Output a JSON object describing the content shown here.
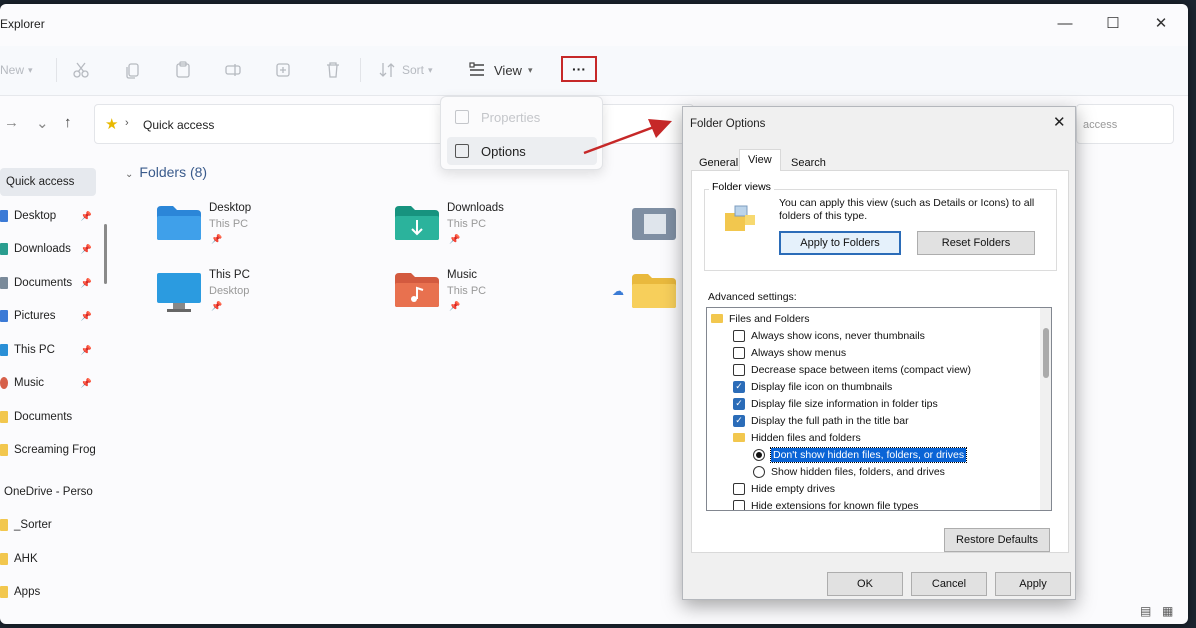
{
  "window": {
    "title": "Explorer",
    "minimize": "—",
    "maximize": "☐",
    "close": "✕"
  },
  "toolbar": {
    "new_label": "New",
    "sort_label": "Sort",
    "view_label": "View",
    "more_label": "···"
  },
  "address": {
    "breadcrumb": "Quick access",
    "search_placeholder": "access"
  },
  "sidebar": {
    "items": [
      {
        "label": "Quick access",
        "color": "#3b7ad6"
      },
      {
        "label": "Desktop",
        "color": "#3b7ad6"
      },
      {
        "label": "Downloads",
        "color": "#2a9d8f"
      },
      {
        "label": "Documents",
        "color": "#7a8a9a"
      },
      {
        "label": "Pictures",
        "color": "#3b7ad6"
      },
      {
        "label": "This PC",
        "color": "#2a8fd6"
      },
      {
        "label": "Music",
        "color": "#d6604a"
      },
      {
        "label": "Documents",
        "color": "#f2c74e"
      },
      {
        "label": "Screaming Frog",
        "color": "#f2c74e"
      },
      {
        "label": "OneDrive - Perso",
        "color": "#1a73e8"
      },
      {
        "label": "_Sorter",
        "color": "#f2c74e"
      },
      {
        "label": "AHK",
        "color": "#f2c74e"
      },
      {
        "label": "Apps",
        "color": "#f2c74e"
      }
    ]
  },
  "content": {
    "section_title": "Folders (8)",
    "folders": [
      {
        "name": "Desktop",
        "sub": "This PC",
        "color": "#2b86d8"
      },
      {
        "name": "Downloads",
        "sub": "This PC",
        "color": "#22a38f"
      },
      {
        "name": "This PC",
        "sub": "Desktop",
        "color": "#2b9be0"
      },
      {
        "name": "Music",
        "sub": "This PC",
        "color": "#e0674a"
      }
    ]
  },
  "more_menu": {
    "properties": "Properties",
    "options": "Options"
  },
  "dialog": {
    "title": "Folder Options",
    "tabs": [
      "General",
      "View",
      "Search"
    ],
    "folder_views_label": "Folder views",
    "folder_views_text": "You can apply this view (such as Details or Icons) to all folders of this type.",
    "apply_to_folders": "Apply to Folders",
    "reset_folders": "Reset Folders",
    "advanced_label": "Advanced settings:",
    "settings": [
      {
        "type": "folder",
        "label": "Files and Folders",
        "indent": 0
      },
      {
        "type": "checkbox",
        "label": "Always show icons, never thumbnails",
        "checked": false,
        "indent": 1
      },
      {
        "type": "checkbox",
        "label": "Always show menus",
        "checked": false,
        "indent": 1
      },
      {
        "type": "checkbox",
        "label": "Decrease space between items (compact view)",
        "checked": false,
        "indent": 1
      },
      {
        "type": "checkbox",
        "label": "Display file icon on thumbnails",
        "checked": true,
        "indent": 1
      },
      {
        "type": "checkbox",
        "label": "Display file size information in folder tips",
        "checked": true,
        "indent": 1
      },
      {
        "type": "checkbox",
        "label": "Display the full path in the title bar",
        "checked": true,
        "indent": 1
      },
      {
        "type": "folder",
        "label": "Hidden files and folders",
        "indent": 1
      },
      {
        "type": "radio",
        "label": "Don't show hidden files, folders, or drives",
        "checked": true,
        "selected": true,
        "indent": 2
      },
      {
        "type": "radio",
        "label": "Show hidden files, folders, and drives",
        "checked": false,
        "indent": 2
      },
      {
        "type": "checkbox",
        "label": "Hide empty drives",
        "checked": false,
        "indent": 1
      },
      {
        "type": "checkbox",
        "label": "Hide extensions for known file types",
        "checked": false,
        "indent": 1
      }
    ],
    "restore_defaults": "Restore Defaults",
    "ok": "OK",
    "cancel": "Cancel",
    "apply": "Apply"
  },
  "colors": {
    "accent": "#2b6cb8",
    "highlight_box": "#c62828",
    "arrow": "#c62828"
  }
}
